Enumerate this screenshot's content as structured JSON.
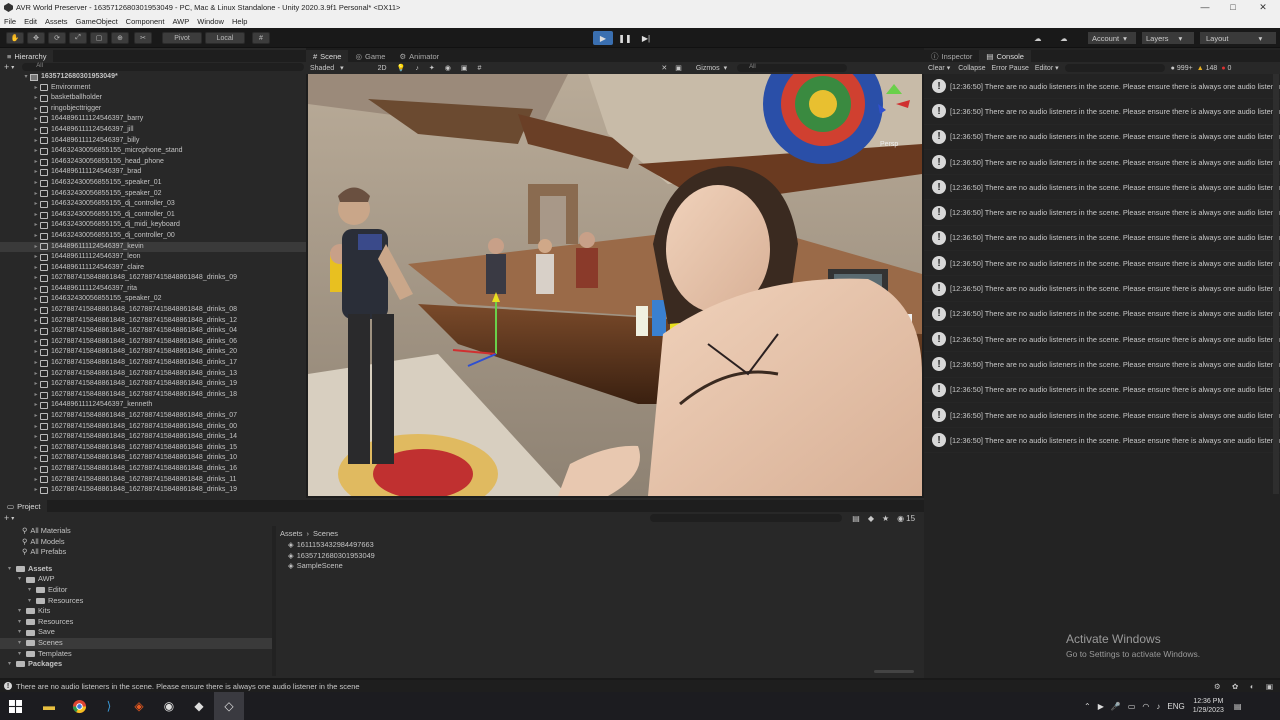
{
  "window": {
    "title": "AVR World Preserver - 163571268030195304​9 - PC, Mac & Linux Standalone - Unity 2020.3.9f1 Personal* <DX11>",
    "controls": [
      "—",
      "□",
      "✕"
    ]
  },
  "menu": [
    "File",
    "Edit",
    "Assets",
    "GameObject",
    "Component",
    "AWP",
    "Window",
    "Help"
  ],
  "toolbar": {
    "pivot_label": "Pivot",
    "local_label": "Local",
    "account_label": "Account",
    "layers_label": "Layers",
    "layout_label": "Layout"
  },
  "hierarchy": {
    "tab_label": "Hierarchy",
    "search_placeholder": "All",
    "root": "163571268030195304​9*",
    "items": [
      "Environment",
      "basketballholder",
      "ringobjecttrigger",
      "1644896111124546397_barry",
      "1644896111124546397_jill",
      "1644896111124546397_billy",
      "164632430056855155_microphone_stand",
      "164632430056855155_head_phone",
      "1644896111124546397_brad",
      "164632430056855155_speaker_01",
      "164632430056855155_speaker_02",
      "164632430056855155_dj_controller_03",
      "164632430056855155_dj_controller_01",
      "164632430056855155_dj_midi_keyboard",
      "164632430056855155_dj_controller_00",
      "1644896111124546397_kevin",
      "1644896111124546397_leon",
      "1644896111124546397_claire",
      "1627887415848861848_1627887415848861848_drinks_09",
      "1644896111124546397_rita",
      "164632430056855155_speaker_02",
      "1627887415848861848_1627887415848861848_drinks_08",
      "1627887415848861848_1627887415848861848_drinks_12",
      "1627887415848861848_1627887415848861848_drinks_04",
      "1627887415848861848_1627887415848861848_drinks_06",
      "1627887415848861848_1627887415848861848_drinks_20",
      "1627887415848861848_1627887415848861848_drinks_17",
      "1627887415848861848_1627887415848861848_drinks_13",
      "1627887415848861848_1627887415848861848_drinks_19",
      "1627887415848861848_1627887415848861848_drinks_18",
      "1644896111124546397_kenneth",
      "1627887415848861848_1627887415848861848_drinks_07",
      "1627887415848861848_1627887415848861848_drinks_00",
      "1627887415848861848_1627887415848861848_drinks_14",
      "1627887415848861848_1627887415848861848_drinks_15",
      "1627887415848861848_1627887415848861848_drinks_10",
      "1627887415848861848_1627887415848861848_drinks_16",
      "1627887415848861848_1627887415848861848_drinks_11",
      "1627887415848861848_1627887415848861848_drinks_19"
    ],
    "selected_index": 15
  },
  "scene": {
    "tabs": [
      "Scene",
      "Game",
      "Animator"
    ],
    "shading_mode": "Shaded",
    "mode_2d": "2D",
    "gizmos_label": "Gizmos",
    "search_placeholder": "All",
    "persp_label": "Persp"
  },
  "console": {
    "tabs": [
      "Inspector",
      "Console"
    ],
    "buttons": [
      "Clear",
      "Collapse",
      "Error Pause",
      "Editor"
    ],
    "count_info": "999+",
    "count_warn": "148",
    "count_error": "0",
    "message": "[12:36:50] There are no audio listeners in the scene. Please ensure there is always one audio listener in the scene",
    "message_count": 15
  },
  "project": {
    "tab_label": "Project",
    "favorites": [
      "All Materials",
      "All Models",
      "All Prefabs"
    ],
    "assets_tree": [
      {
        "label": "Assets",
        "depth": 0,
        "bold": true
      },
      {
        "label": "AWP",
        "depth": 1
      },
      {
        "label": "Editor",
        "depth": 2
      },
      {
        "label": "Resources",
        "depth": 2
      },
      {
        "label": "Kits",
        "depth": 1
      },
      {
        "label": "Resources",
        "depth": 1
      },
      {
        "label": "Save",
        "depth": 1
      },
      {
        "label": "Scenes",
        "depth": 1,
        "selected": true
      },
      {
        "label": "Templates",
        "depth": 1
      },
      {
        "label": "Packages",
        "depth": 0,
        "bold": true
      }
    ],
    "breadcrumb": [
      "Assets",
      "Scenes"
    ],
    "files": [
      "1611153432984497663",
      "163571268030195304​9",
      "SampleScene"
    ],
    "hidden_count": "15"
  },
  "status_message": "There are no audio listeners in the scene. Please ensure there is always one audio listener in the scene",
  "activate_windows": {
    "title": "Activate Windows",
    "subtitle": "Go to Settings to activate Windows."
  },
  "taskbar": {
    "time": "12:36 PM",
    "date": "1/29/2023",
    "language": "ENG"
  }
}
